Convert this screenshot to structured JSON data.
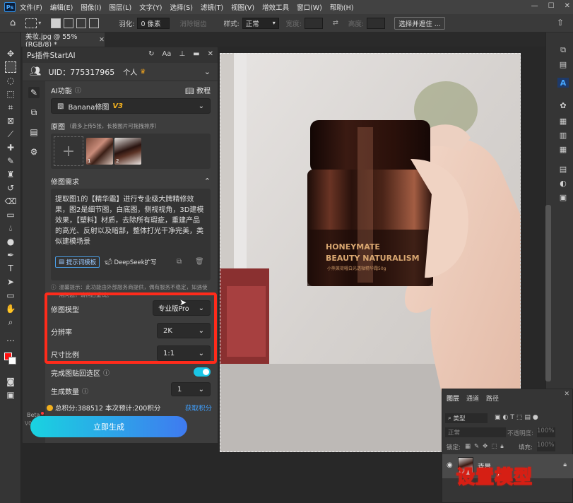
{
  "menubar": {
    "app_icon": "Ps",
    "items": [
      "文件(F)",
      "编辑(E)",
      "图像(I)",
      "图层(L)",
      "文字(Y)",
      "选择(S)",
      "滤镜(T)",
      "视图(V)",
      "增效工具",
      "窗口(W)",
      "帮助(H)"
    ]
  },
  "options": {
    "feather_label": "羽化:",
    "feather_value": "0 像素",
    "antialias_label": "消除锯齿",
    "style_label": "样式:",
    "style_value": "正常",
    "width_label": "宽度:",
    "height_label": "高度:",
    "select_mask_button": "选择并遮住 ..."
  },
  "document": {
    "tab_title": "美妆.jpg @ 55%(RGB/8) *"
  },
  "plugin": {
    "title": "Ps插件StartAI",
    "uid": "UID：775317965",
    "account_type": "个人",
    "section_ai": "AI功能",
    "tutorial": "教程",
    "function_name": "Banana修图",
    "function_version": "V3",
    "original_label": "原图",
    "original_hint": "（最多上传5张，长按图片可拖拽排序）",
    "thumb1_num": "1",
    "thumb2_num": "2",
    "requirement_label": "修图需求",
    "prompt": "提取图1的【精华霜】进行专业级大牌精修效果，图2是细节图，白底图，侧视视角，3D建模效果，【塑料】材质，去除所有瑕疵，重建产品的高光、反射以及暗部，整体打光干净完美，类似建模场景",
    "prompt_template_btn": "提示词模板",
    "deepseek_btn": "DeepSeek扩写",
    "notice": "温馨提示：此功能由外部服务商提供，偶有服务不稳定，如遇使用问题，请稍后重试。",
    "model_label": "修图模型",
    "model_value": "专业版Pro",
    "resolution_label": "分辨率",
    "resolution_value": "2K",
    "ratio_label": "尺寸比例",
    "ratio_value": "1:1",
    "paste_label": "完成图贴回选区",
    "paste_toggle_on": true,
    "count_label": "生成数量",
    "count_value": "1",
    "points_text": "总积分:388512  本次预计:200积分",
    "get_points": "获取积分",
    "beta_label": "Beta",
    "version": "V0.24.2",
    "generate_button": "立即生成"
  },
  "photo": {
    "label_line1": "HONEYMATE",
    "label_line2": "BEAUTY NATURALISM",
    "label_small": "小熊莱荷曜白光透微精华霜50g"
  },
  "layers": {
    "tabs": [
      "图层",
      "通道",
      "路径"
    ],
    "kind_label": "类型",
    "blend_mode": "正常",
    "opacity_label": "不透明度:",
    "opacity_value": "100%",
    "lock_label": "锁定:",
    "fill_label": "填充:",
    "fill_value": "100%",
    "layer_name": "背景"
  },
  "caption": "设置模型",
  "colors": {
    "accent_red": "#ff2b1b",
    "generate_gradient_start": "#19d3e0",
    "generate_gradient_end": "#3f7af0",
    "points_coin": "#f2b01e",
    "link_blue": "#3fa0ff"
  }
}
